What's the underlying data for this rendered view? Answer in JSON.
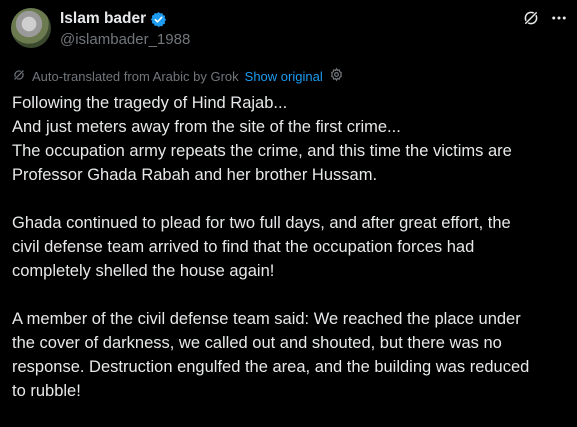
{
  "author": {
    "display_name": "Islam bader",
    "handle": "@islambader_1988",
    "verified_icon": "verified-badge-icon"
  },
  "actions": {
    "grok_icon": "grok-icon",
    "more_icon": "more-options-icon"
  },
  "translation": {
    "label": "Auto-translated from Arabic by Grok",
    "show_original": "Show original"
  },
  "post": {
    "paragraphs": [
      [
        " Following the tragedy of Hind Rajab...",
        "And just meters away from the site of the first crime...",
        "The occupation army repeats the crime, and this time the victims are",
        "Professor Ghada Rabah and her brother Hussam."
      ],
      [
        "Ghada continued to plead for two full days, and after great effort, the",
        "civil defense team arrived to find that the occupation forces had",
        "completely shelled the house again!"
      ],
      [
        "A member of the civil defense team said: We reached the place under",
        "the cover of darkness, we called out and shouted, but there was no",
        "response. Destruction engulfed the area, and the building was reduced",
        "to rubble!"
      ]
    ]
  },
  "colors": {
    "background": "#000000",
    "text": "#e7e9ea",
    "muted": "#71767b",
    "accent": "#1d9bf0"
  }
}
